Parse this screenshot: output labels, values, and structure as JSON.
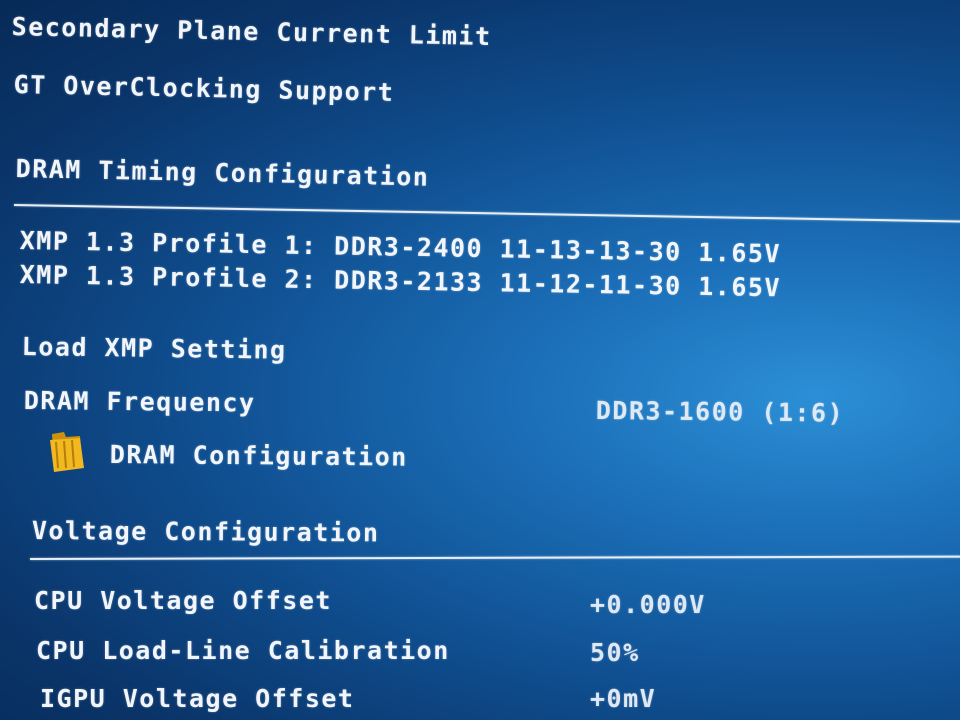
{
  "menu": {
    "secondary_plane_current_limit": "Secondary Plane Current Limit",
    "gt_overclocking_support": "GT OverClocking Support"
  },
  "dram_timing": {
    "heading": "DRAM Timing Configuration",
    "xmp_profile_1": "XMP 1.3 Profile 1: DDR3-2400 11-13-13-30 1.65V",
    "xmp_profile_2": "XMP 1.3 Profile 2: DDR3-2133 11-12-11-30 1.65V",
    "load_xmp_setting": "Load XMP Setting",
    "dram_frequency_label": "DRAM Frequency",
    "dram_frequency_value": "DDR3-1600 (1:6)",
    "dram_configuration": "DRAM Configuration",
    "dram_configuration_icon": "folder-icon"
  },
  "voltage": {
    "heading": "Voltage Configuration",
    "cpu_voltage_offset_label": "CPU Voltage Offset",
    "cpu_voltage_offset_value": "+0.000V",
    "cpu_llc_label": "CPU Load-Line Calibration",
    "cpu_llc_value": "50%",
    "igpu_voltage_offset_label": "IGPU Voltage Offset",
    "igpu_voltage_offset_value": "+0mV"
  },
  "colors": {
    "background": "#0f4d8e",
    "text": "#f2f6fb",
    "folder": "#f2b820"
  }
}
